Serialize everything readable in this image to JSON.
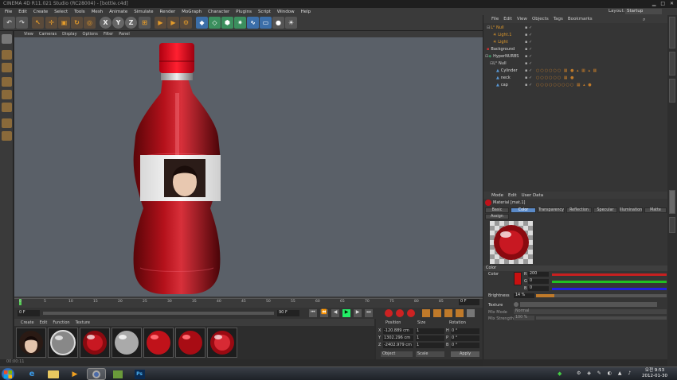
{
  "app": {
    "title": "CINEMA 4D R11.021 Studio (RC28004) - [bottle.c4d]",
    "menus": [
      "File",
      "Edit",
      "Create",
      "Select",
      "Tools",
      "Mesh",
      "Animate",
      "Simulate",
      "Render",
      "MoGraph",
      "Character",
      "Plugins",
      "Script",
      "Window",
      "Help"
    ],
    "layout_label": "Layout:",
    "layout_value": "Startup"
  },
  "viewport": {
    "menus": [
      "View",
      "Cameras",
      "Display",
      "Options",
      "Filter",
      "Panel"
    ]
  },
  "timeline": {
    "ticks": [
      "0",
      "5",
      "10",
      "15",
      "20",
      "25",
      "30",
      "35",
      "40",
      "45",
      "50",
      "55",
      "60",
      "65",
      "70",
      "75",
      "80",
      "85",
      "90"
    ],
    "start_field": "0 F",
    "mid_field": "90 F",
    "current_field": "0 F"
  },
  "material_manager": {
    "menus": [
      "Create",
      "Edit",
      "Function",
      "Texture"
    ],
    "materials": [
      {
        "icon": "portrait-material-icon"
      },
      {
        "icon": "glass-material-icon"
      },
      {
        "icon": "red-glass-material-icon"
      },
      {
        "icon": "gray-sphere-material-icon"
      },
      {
        "icon": "red-sphere-material-icon"
      },
      {
        "icon": "red-sphere-material-icon"
      },
      {
        "icon": "red-glass-material-icon"
      }
    ]
  },
  "coordinates": {
    "headers": [
      "Position",
      "Size",
      "Rotation"
    ],
    "rows": [
      {
        "axis": "X",
        "pos": "-120.889 cm",
        "size": "1",
        "rot_label": "H",
        "rot": "0 °"
      },
      {
        "axis": "Y",
        "pos": "1302.296 cm",
        "size": "1",
        "rot_label": "P",
        "rot": "0 °"
      },
      {
        "axis": "Z",
        "pos": "-2402.979 cm",
        "size": "1",
        "rot_label": "B",
        "rot": "0 °"
      }
    ],
    "mode_select": "Object",
    "size_select": "Scale",
    "apply": "Apply"
  },
  "status": {
    "text": "00:00:11"
  },
  "object_manager": {
    "menus": [
      "File",
      "Edit",
      "View",
      "Objects",
      "Tags",
      "Bookmarks"
    ],
    "objects": [
      {
        "name": "Null",
        "color": "#e39b2b",
        "indent": 0
      },
      {
        "name": "Light.1",
        "color": "#e39b2b",
        "indent": 1
      },
      {
        "name": "Light",
        "color": "#e39b2b",
        "indent": 1
      },
      {
        "name": "Background",
        "color": "#cfcfcf",
        "indent": 0
      },
      {
        "name": "HyperNURBS",
        "color": "#cfcfcf",
        "indent": 0
      },
      {
        "name": "Null",
        "color": "#cfcfcf",
        "indent": 1
      },
      {
        "name": "Cylinder",
        "color": "#cfcfcf",
        "indent": 2
      },
      {
        "name": "neck",
        "color": "#cfcfcf",
        "indent": 2
      },
      {
        "name": "cap",
        "color": "#cfcfcf",
        "indent": 2
      }
    ]
  },
  "attributes": {
    "menus": [
      "Mode",
      "Edit",
      "User Data"
    ],
    "material_title": "Material [mat.1]",
    "tabs": [
      "Basic",
      "Color",
      "Transparency",
      "Reflection",
      "Specular",
      "Illumination",
      "Matte",
      "Assign"
    ],
    "section": "Color",
    "color_label": "Color",
    "rgb": [
      {
        "ch": "R",
        "val": "200",
        "color": "#d01818"
      },
      {
        "ch": "G",
        "val": "0",
        "color": "#18c018"
      },
      {
        "ch": "B",
        "val": "0",
        "color": "#2020e0"
      }
    ],
    "brightness_label": "Brightness",
    "brightness_val": "14 %",
    "brightness_level": 0.14,
    "texture_label": "Texture",
    "mix_mode_label": "Mix Mode",
    "mix_mode_val": "Normal",
    "mix_strength_label": "Mix Strength",
    "mix_strength_val": "100 %"
  },
  "taskbar": {
    "time": "오전 9:53",
    "date": "2012-01-30"
  },
  "colors": {
    "accent": "#e39b2b",
    "bottle_red": "#b4111b",
    "viewport_bg": "#5a6068"
  }
}
